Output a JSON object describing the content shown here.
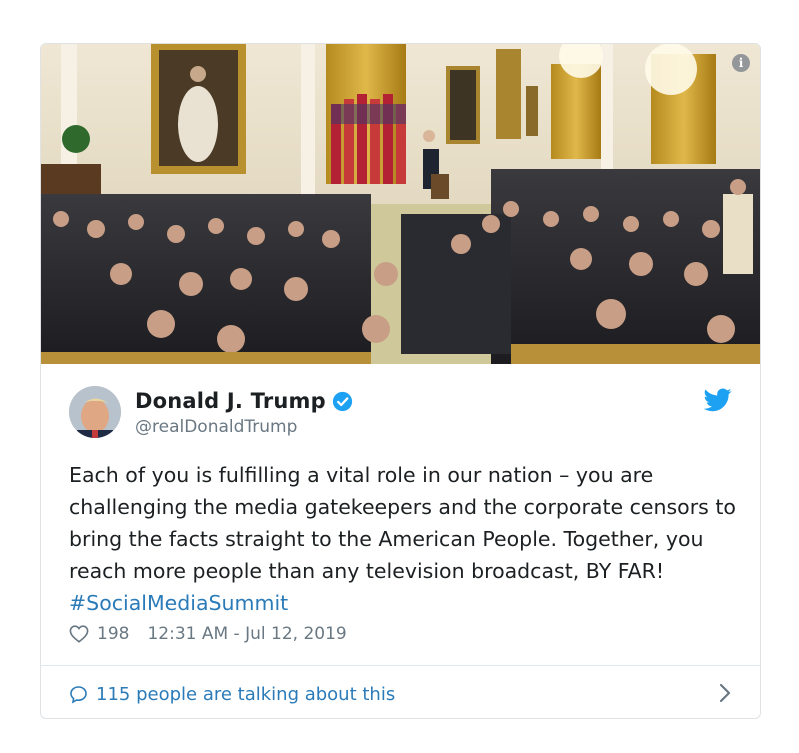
{
  "photo": {
    "description_icon": "info-icon",
    "info_glyph": "i"
  },
  "tweet": {
    "display_name": "Donald J. Trump",
    "handle": "@realDonaldTrump",
    "verified": true,
    "text_main": "Each of you is fulfilling a vital role in our nation – you are challenging the media gatekeepers and the corporate censors to bring the facts straight to the American People. Together, you reach more people than any television broadcast, BY FAR! ",
    "hashtag": "#SocialMediaSummit",
    "likes": "198",
    "timestamp": "12:31 AM - Jul 12, 2019",
    "talking": "115 people are talking about this"
  },
  "colors": {
    "link": "#2b7bb9",
    "text": "#1c2022",
    "muted": "#697882",
    "verified": "#1da1f2",
    "twitter_blue": "#1da1f2"
  },
  "icons": [
    "info-icon",
    "verified-icon",
    "twitter-bird-icon",
    "heart-icon",
    "speech-bubble-icon",
    "chevron-right-icon"
  ]
}
